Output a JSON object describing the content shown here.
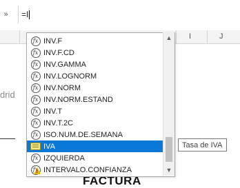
{
  "formula_bar": {
    "namebox_glyph": "»",
    "formula_text": "=I"
  },
  "columns": {
    "i": "I",
    "j": "J"
  },
  "sheet": {
    "left_partial_text": "drid",
    "heading_partial": "FACTURA"
  },
  "autocomplete": {
    "items": [
      {
        "name": "INV.F",
        "icon": "function-icon"
      },
      {
        "name": "INV.F.CD",
        "icon": "function-icon"
      },
      {
        "name": "INV.GAMMA",
        "icon": "function-icon"
      },
      {
        "name": "INV.LOGNORM",
        "icon": "function-icon"
      },
      {
        "name": "INV.NORM",
        "icon": "function-icon"
      },
      {
        "name": "INV.NORM.ESTAND",
        "icon": "function-icon"
      },
      {
        "name": "INV.T",
        "icon": "function-icon"
      },
      {
        "name": "INV.T.2C",
        "icon": "function-icon"
      },
      {
        "name": "ISO.NUM.DE.SEMANA",
        "icon": "function-icon"
      },
      {
        "name": "IVA",
        "icon": "defined-name-icon",
        "selected": true
      },
      {
        "name": "IZQUIERDA",
        "icon": "function-icon"
      },
      {
        "name": "INTERVALO.CONFIANZA",
        "icon": "compatibility-function-icon"
      }
    ],
    "selected_color": "#0a78d7"
  },
  "tooltip": {
    "text": "Tasa de IVA"
  }
}
